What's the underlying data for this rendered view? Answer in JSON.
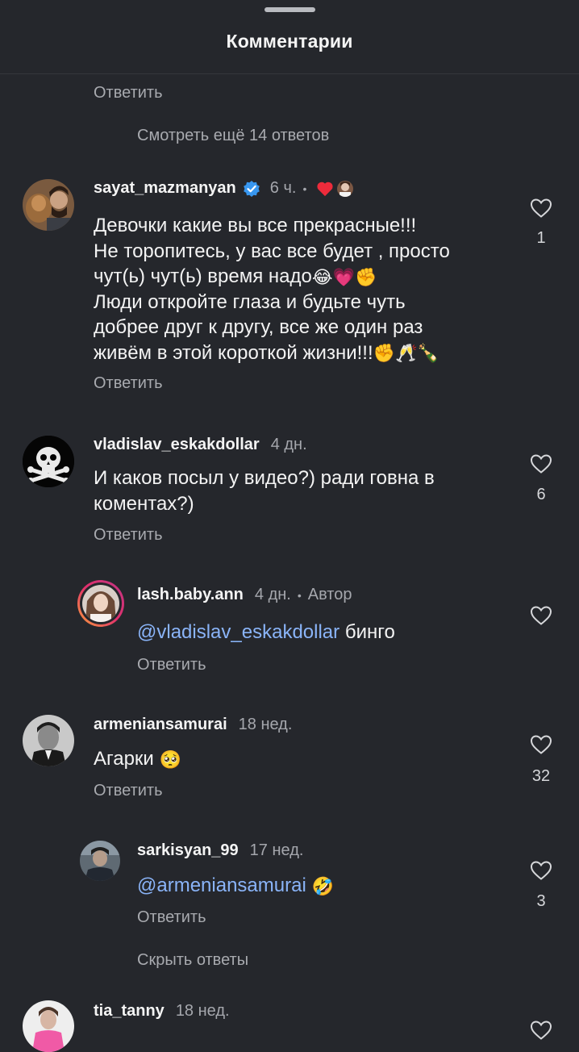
{
  "header": {
    "title": "Комментарии"
  },
  "top": {
    "reply": "Ответить",
    "view_more": "Смотреть ещё 14 ответов"
  },
  "comments": [
    {
      "username": "sayat_mazmanyan",
      "verified": true,
      "time": "6 ч.",
      "dot": "•",
      "lines": [
        "Девочки какие вы все прекрасные!!!",
        "Не торопитесь, у вас все будет , просто",
        "чут(ь) чут(ь) время надо",
        "Люди откройте глаза и будьте чуть",
        "добрее друг к  другу, все же один раз",
        "живём в этой короткой  жизни!!!"
      ],
      "emoji_line3": "😂💗✊",
      "emoji_line6": "✊🥂🍾",
      "reply": "Ответить",
      "likes": "1"
    },
    {
      "username": "vladislav_eskakdollar",
      "time": "4 дн.",
      "lines": [
        "И каков посыл у видео?) ради говна в",
        "коментах?)"
      ],
      "reply": "Ответить",
      "likes": "6"
    },
    {
      "username": "lash.baby.ann",
      "time": "4 дн.",
      "dot": "•",
      "author": "Автор",
      "mention": "@vladislav_eskakdollar",
      "text": " бинго",
      "reply": "Ответить"
    },
    {
      "username": "armeniansamurai",
      "time": "18 нед.",
      "text": "Агарки ",
      "emoji": "🥺",
      "reply": "Ответить",
      "likes": "32"
    },
    {
      "username": "sarkisyan_99",
      "time": "17 нед.",
      "mention": "@armeniansamurai",
      "emoji": "🤣",
      "reply": "Ответить",
      "likes": "3"
    },
    {
      "username": "tia_tanny",
      "time": "18 нед."
    }
  ],
  "hide_replies": "Скрыть ответы",
  "icons": {
    "heart": "heart-outline-icon",
    "verified": "verified-badge-icon",
    "creator_heart": "red-heart-icon"
  },
  "colors": {
    "background": "#25272c",
    "mention": "#8ab4f8",
    "verified": "#3897f0",
    "creator_heart": "#ed2b3b"
  }
}
